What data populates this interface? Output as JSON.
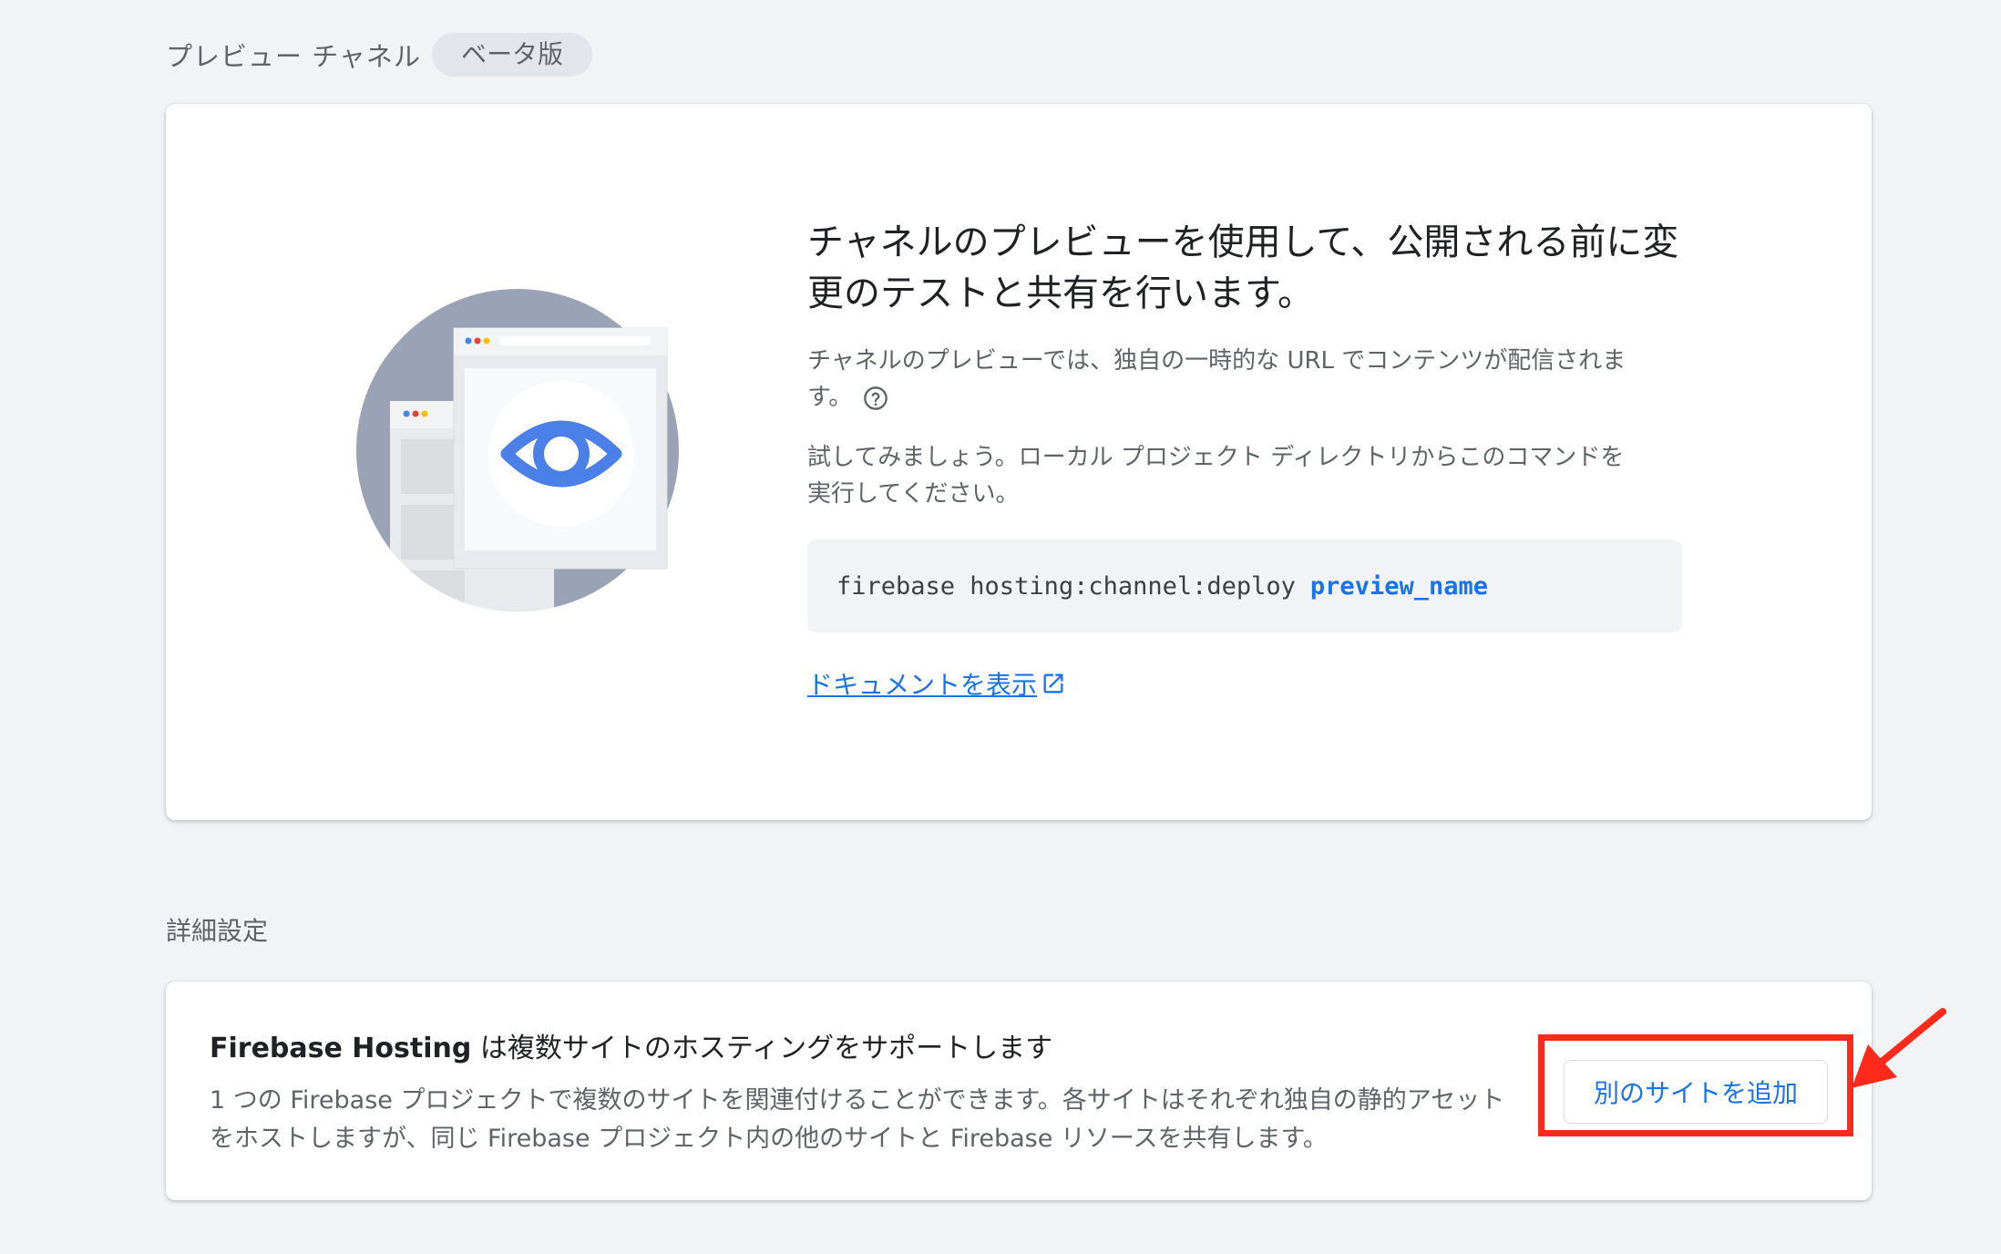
{
  "preview_channel": {
    "section_title": "プレビュー チャネル",
    "beta_badge": "ベータ版",
    "headline_line1": "チャネルのプレビューを使用して、公開される前に変",
    "headline_line2": "更のテストと共有を行います。",
    "description_line1": "チャネルのプレビューでは、独自の一時的な URL でコンテンツが配信されま",
    "description_line2": "す。",
    "try_line1": "試してみましょう。ローカル プロジェクト ディレクトリからこのコマンドを",
    "try_line2": "実行してください。",
    "command": "firebase hosting:channel:deploy",
    "command_param": "preview_name",
    "docs_link": "ドキュメントを表示",
    "icons": {
      "illustration": "preview-eye-illustration",
      "help": "help-circle-icon",
      "external": "open-in-new-icon"
    }
  },
  "advanced": {
    "section_title": "詳細設定",
    "title_bold": "Firebase Hosting",
    "title_rest": " は複数サイトのホスティングをサポートします",
    "description_line1": "1 つの Firebase プロジェクトで複数のサイトを関連付けることができます。各サイトはそれぞれ独自の静的アセット",
    "description_line2": "をホストしますが、同じ Firebase プロジェクト内の他のサイトと Firebase リソースを共有します。",
    "add_site_button": "別のサイトを追加"
  },
  "colors": {
    "accent": "#1a73e8",
    "annotation": "#ff2a1a",
    "background": "#f1f3f4"
  }
}
